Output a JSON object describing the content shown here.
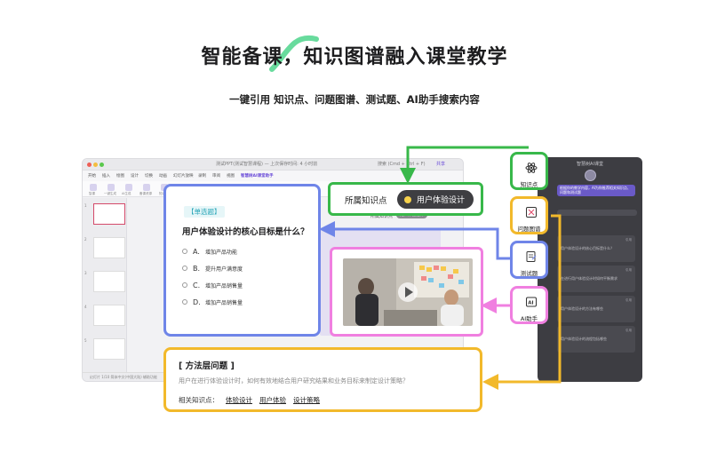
{
  "headline": "智能备课，知识图谱融入课堂教学",
  "subline": "一键引用 知识点、问题图谱、测试题、AI助手搜索内容",
  "colors": {
    "green": "#38b84a",
    "blue": "#6f85e8",
    "pink": "#f07fe0",
    "yellow": "#f2b92b",
    "purple": "#6a4bd8"
  },
  "ppt": {
    "window_title": "测试PPT(测试智慧课程) — 上次保存时间: 4 小时前",
    "search_placeholder": "搜索 (Cmd + Ctrl + F)",
    "share_label": "共享",
    "menu": [
      "开始",
      "插入",
      "绘图",
      "设计",
      "切换",
      "动画",
      "幻灯片放映",
      "录制",
      "审阅",
      "视图",
      "智慧树AI课堂助手"
    ],
    "ribbon": [
      "智课",
      "一键生成",
      "AI生成",
      "备课资源",
      "知识点",
      "问题图谱",
      "测试题",
      "AI助手"
    ],
    "thumb_numbers": [
      "1",
      "2",
      "3",
      "4",
      "5"
    ],
    "status": "幻灯片 1/10   简体中文(中国大陆)   辅助功能"
  },
  "panel": {
    "title": "智慧树AI课堂",
    "banner": "根据你的教学内容，AI为你推荐相关知识点、问题和测试题",
    "cards": [
      {
        "text": "用户体验设计的核心目标是什么？",
        "tag": "引用"
      },
      {
        "text": "在进行用户体验设计时如何平衡需求",
        "tag": "引用"
      },
      {
        "text": "用户体验设计的方法有哪些",
        "tag": "引用"
      },
      {
        "text": "用户体验设计的流程包括哪些",
        "tag": "引用"
      }
    ]
  },
  "ppt_kp": {
    "caption": "所属知识点",
    "chip": "用户体验设计"
  },
  "question": {
    "tag": "【单选题】",
    "title": "用户体验设计的核心目标是什么？",
    "options": [
      {
        "letter": "A.",
        "text": "增加产品功能"
      },
      {
        "letter": "B.",
        "text": "提升用户满意度"
      },
      {
        "letter": "C.",
        "text": "增加产品销售量"
      },
      {
        "letter": "D.",
        "text": "增加产品销售量"
      }
    ]
  },
  "knowledge": {
    "label": "所属知识点",
    "chip": "用户体验设计"
  },
  "method": {
    "title": "[ 方法层问题 ]",
    "desc": "用户在进行体验设计时，如何有效地结合用户研究结果和业务目标来制定设计策略？",
    "related_label": "相关知识点：",
    "related": [
      "体验设计",
      "用户体验",
      "设计策略"
    ]
  },
  "tiles": [
    {
      "label": "知识点",
      "icon": "atom-icon"
    },
    {
      "label": "问题图谱",
      "icon": "question-map-icon"
    },
    {
      "label": "测试题",
      "icon": "test-paper-icon"
    },
    {
      "label": "AI助手",
      "icon": "ai-assistant-icon"
    }
  ]
}
